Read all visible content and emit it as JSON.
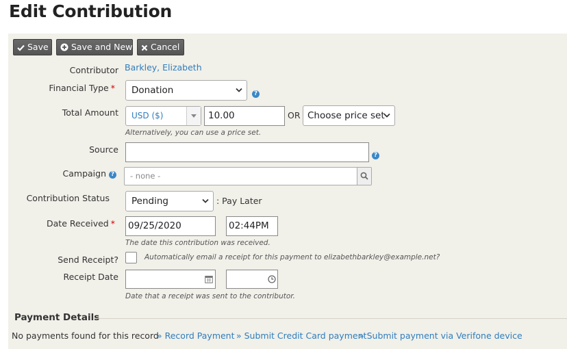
{
  "page_title": "Edit Contribution",
  "toolbar": {
    "save": "Save",
    "save_and_new": "Save and New",
    "cancel": "Cancel"
  },
  "contributor": {
    "label": "Contributor",
    "value": "Barkley, Elizabeth"
  },
  "financial_type": {
    "label": "Financial Type",
    "value": "Donation"
  },
  "total_amount": {
    "label": "Total Amount",
    "currency": "USD ($)",
    "amount": "10.00",
    "or": "OR",
    "price_set": "Choose price set",
    "note": "Alternatively, you can use a price set."
  },
  "source": {
    "label": "Source",
    "value": ""
  },
  "campaign": {
    "label": "Campaign",
    "value": "- none -"
  },
  "status": {
    "label": "Contribution Status",
    "value": "Pending",
    "suffix": ": Pay Later"
  },
  "date_received": {
    "label": "Date Received",
    "date": "09/25/2020",
    "time": "02:44PM",
    "note": "The date this contribution was received."
  },
  "send_receipt": {
    "label": "Send Receipt?",
    "note": "Automatically email a receipt for this payment to elizabethbarkley@example.net?"
  },
  "receipt_date": {
    "label": "Receipt Date",
    "date": "",
    "time": "",
    "note": "Date that a receipt was sent to the contributor."
  },
  "payment_details": {
    "title": "Payment Details",
    "none_text": "No payments found for this record",
    "links": [
      "» Record Payment",
      "» Submit Credit Card payment",
      "» Submit payment via Verifone device"
    ]
  },
  "colors": {
    "link": "#2f7dbd",
    "panel": "#f1f0e9",
    "button": "#5e5e5e",
    "required": "#cc0000"
  }
}
